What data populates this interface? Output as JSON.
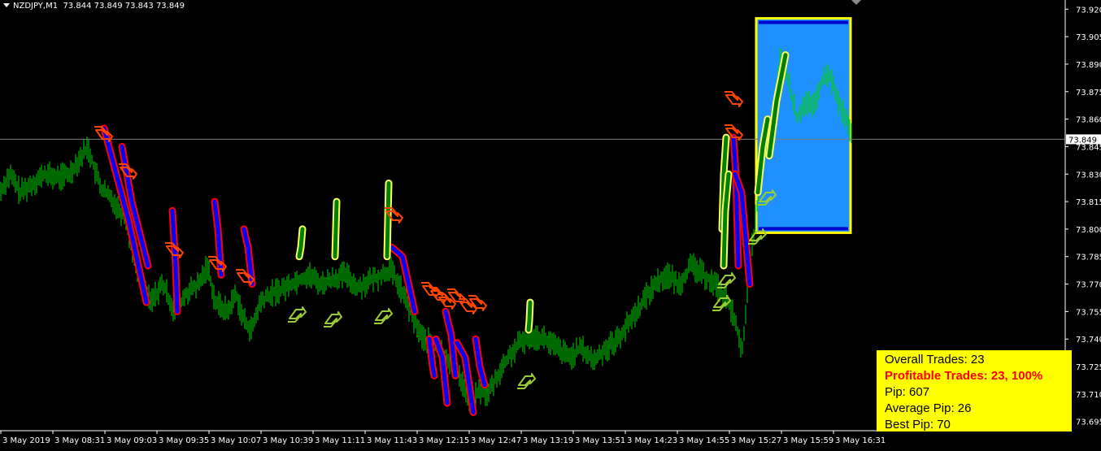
{
  "header": {
    "symbol_timeframe": "NZDJPY,M1",
    "ohlc": "73.844 73.849 73.843 73.849"
  },
  "chart_data": {
    "type": "candlestick",
    "symbol": "NZDJPY",
    "timeframe": "M1",
    "ylim": [
      73.69,
      73.925
    ],
    "yticks": [
      "73.920",
      "73.905",
      "73.890",
      "73.875",
      "73.860",
      "73.845",
      "73.830",
      "73.815",
      "73.800",
      "73.785",
      "73.770",
      "73.755",
      "73.740",
      "73.725",
      "73.710",
      "73.695"
    ],
    "current_price": "73.849",
    "xtick_labels": [
      "3 May 2019",
      "3 May 08:31",
      "3 May 09:03",
      "3 May 09:35",
      "3 May 10:07",
      "3 May 10:39",
      "3 May 11:11",
      "3 May 11:43",
      "3 May 12:15",
      "3 May 12:47",
      "3 May 13:19",
      "3 May 13:51",
      "3 May 14:23",
      "3 May 14:55",
      "3 May 15:27",
      "3 May 15:59",
      "3 May 16:31"
    ],
    "price_path": [
      [
        0,
        73.82
      ],
      [
        12,
        73.83
      ],
      [
        25,
        73.82
      ],
      [
        40,
        73.825
      ],
      [
        55,
        73.83
      ],
      [
        70,
        73.828
      ],
      [
        85,
        73.83
      ],
      [
        100,
        73.84
      ],
      [
        108,
        73.845
      ],
      [
        118,
        73.83
      ],
      [
        125,
        73.822
      ],
      [
        140,
        73.815
      ],
      [
        155,
        73.805
      ],
      [
        165,
        73.785
      ],
      [
        175,
        73.77
      ],
      [
        185,
        73.76
      ],
      [
        200,
        73.77
      ],
      [
        215,
        73.755
      ],
      [
        230,
        73.765
      ],
      [
        245,
        73.77
      ],
      [
        255,
        73.78
      ],
      [
        265,
        73.76
      ],
      [
        280,
        73.755
      ],
      [
        290,
        73.765
      ],
      [
        300,
        73.75
      ],
      [
        310,
        73.745
      ],
      [
        320,
        73.76
      ],
      [
        335,
        73.765
      ],
      [
        350,
        73.768
      ],
      [
        365,
        73.772
      ],
      [
        380,
        73.775
      ],
      [
        395,
        73.77
      ],
      [
        410,
        73.773
      ],
      [
        425,
        73.775
      ],
      [
        440,
        73.768
      ],
      [
        455,
        73.772
      ],
      [
        470,
        73.775
      ],
      [
        480,
        73.778
      ],
      [
        490,
        73.77
      ],
      [
        500,
        73.76
      ],
      [
        510,
        73.75
      ],
      [
        520,
        73.74
      ],
      [
        530,
        73.738
      ],
      [
        540,
        73.735
      ],
      [
        550,
        73.73
      ],
      [
        560,
        73.725
      ],
      [
        570,
        73.715
      ],
      [
        580,
        73.705
      ],
      [
        590,
        73.712
      ],
      [
        600,
        73.71
      ],
      [
        612,
        73.72
      ],
      [
        625,
        73.73
      ],
      [
        640,
        73.738
      ],
      [
        655,
        73.742
      ],
      [
        670,
        73.74
      ],
      [
        685,
        73.735
      ],
      [
        700,
        73.73
      ],
      [
        715,
        73.735
      ],
      [
        730,
        73.728
      ],
      [
        745,
        73.735
      ],
      [
        760,
        73.74
      ],
      [
        775,
        73.75
      ],
      [
        790,
        73.76
      ],
      [
        805,
        73.77
      ],
      [
        820,
        73.775
      ],
      [
        835,
        73.77
      ],
      [
        850,
        73.78
      ],
      [
        865,
        73.775
      ],
      [
        880,
        73.77
      ],
      [
        895,
        73.76
      ],
      [
        905,
        73.75
      ],
      [
        912,
        73.73
      ],
      [
        920,
        73.77
      ],
      [
        930,
        73.81
      ],
      [
        940,
        73.84
      ],
      [
        950,
        73.86
      ],
      [
        960,
        73.895
      ],
      [
        970,
        73.88
      ],
      [
        980,
        73.86
      ],
      [
        990,
        73.87
      ],
      [
        1000,
        73.865
      ],
      [
        1010,
        73.88
      ],
      [
        1020,
        73.885
      ],
      [
        1030,
        73.87
      ],
      [
        1040,
        73.86
      ],
      [
        1048,
        73.849
      ]
    ],
    "sell_signals": [
      [
        73.855,
        73.805,
        73.76
      ],
      [
        73.845,
        73.815,
        73.78
      ],
      [
        73.81,
        73.78,
        73.755
      ],
      [
        73.815,
        73.8,
        73.775
      ],
      [
        73.8,
        73.79,
        73.77
      ],
      [
        73.79,
        73.785,
        73.755
      ],
      [
        73.74,
        73.725,
        73.72
      ],
      [
        73.74,
        73.73,
        73.705
      ],
      [
        73.755,
        73.742,
        73.72
      ],
      [
        73.738,
        73.73,
        73.7
      ],
      [
        73.74,
        73.725,
        73.715
      ],
      [
        73.85,
        73.83,
        73.78
      ],
      [
        73.83,
        73.82,
        73.77
      ]
    ],
    "buy_signals": [
      [
        73.785,
        73.79,
        73.8
      ],
      [
        73.785,
        73.8,
        73.815
      ],
      [
        73.785,
        73.805,
        73.825
      ],
      [
        73.745,
        73.75,
        73.76
      ],
      [
        73.8,
        73.83,
        73.85
      ],
      [
        73.82,
        73.845,
        73.86
      ],
      [
        73.84,
        73.87,
        73.895
      ],
      [
        73.78,
        73.81,
        73.83
      ]
    ],
    "highlight_zone": {
      "from_label": "3 May 15:27",
      "price_high": 73.915,
      "price_low": 73.798
    }
  },
  "colors": {
    "background": "#000000",
    "candles": "#00d200",
    "axis_text": "#ffffff",
    "current_price_line": "#7f7f7f",
    "sell_capsule": "#0000ff",
    "sell_outline": "#ff0000",
    "buy_capsule": "#008000",
    "buy_outline": "#ffff66",
    "sell_arrow": "#ff4500",
    "buy_arrow": "#9acd32",
    "zone_fill": "#1e90ff",
    "zone_border": "#ffff00",
    "stats_bg": "#ffff00"
  },
  "stats": {
    "overall": "Overall Trades: 23",
    "profitable": "Profitable Trades: 23, 100%",
    "pip": "Pip: 607",
    "average": "Average Pip: 26",
    "best": "Best Pip: 70"
  }
}
